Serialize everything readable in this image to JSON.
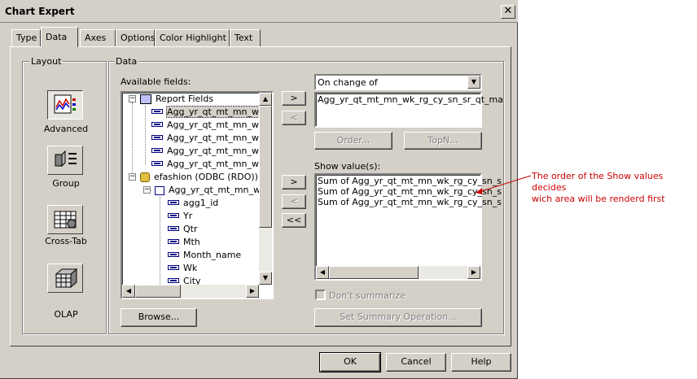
{
  "window": {
    "title": "Chart Expert",
    "close_glyph": "✕"
  },
  "tabs": [
    {
      "label": "Type",
      "active": false
    },
    {
      "label": "Data",
      "active": true
    },
    {
      "label": "Axes",
      "active": false
    },
    {
      "label": "Options",
      "active": false
    },
    {
      "label": "Color Highlight",
      "active": false
    },
    {
      "label": "Text",
      "active": false
    }
  ],
  "layout": {
    "group_label": "Layout",
    "items": [
      {
        "label": "Advanced",
        "selected": true,
        "icon": "advanced-chart-icon"
      },
      {
        "label": "Group",
        "selected": false,
        "icon": "group-chart-icon"
      },
      {
        "label": "Cross-Tab",
        "selected": false,
        "icon": "crosstab-chart-icon"
      },
      {
        "label": "OLAP",
        "selected": false,
        "icon": "olap-chart-icon"
      }
    ]
  },
  "data": {
    "group_label": "Data",
    "available_fields_label": "Available fields:",
    "tree": {
      "report_fields": {
        "label": "Report Fields",
        "children": [
          "Agg_yr_qt_mt_mn_wk_",
          "Agg_yr_qt_mt_mn_wk_",
          "Agg_yr_qt_mt_mn_wk_",
          "Agg_yr_qt_mt_mn_wk_",
          "Agg_yr_qt_mt_mn_wk_"
        ]
      },
      "datasource": {
        "label": "efashion (ODBC (RDO))",
        "table": "Agg_yr_qt_mt_mn_wk_",
        "columns": [
          "agg1_id",
          "Yr",
          "Qtr",
          "Mth",
          "Month_name",
          "Wk",
          "City"
        ]
      }
    },
    "browse_label": "Browse...",
    "on_change_of": {
      "selected": "On change of",
      "items": [
        "Agg_yr_qt_mt_mn_wk_rg_cy_sn_sr_qt_ma"
      ]
    },
    "order_label": "Order...",
    "topn_label": "TopN...",
    "show_values_label": "Show value(s):",
    "show_values": [
      "Sum of Agg_yr_qt_mt_mn_wk_rg_cy_sn_s",
      "Sum of Agg_yr_qt_mt_mn_wk_rg_cy_sn_s",
      "Sum of Agg_yr_qt_mt_mn_wk_rg_cy_sn_s"
    ],
    "dont_summarize_label": "Don't summarize",
    "set_summary_label": "Set Summary Operation...",
    "move_buttons": {
      "add": ">",
      "remove": "<",
      "remove_all": "<<"
    }
  },
  "footer": {
    "ok": "OK",
    "cancel": "Cancel",
    "help": "Help"
  },
  "annotation": {
    "line1": "The order of the Show values decides",
    "line2": "wich area will be renderd first",
    "color": "#cc0000"
  }
}
